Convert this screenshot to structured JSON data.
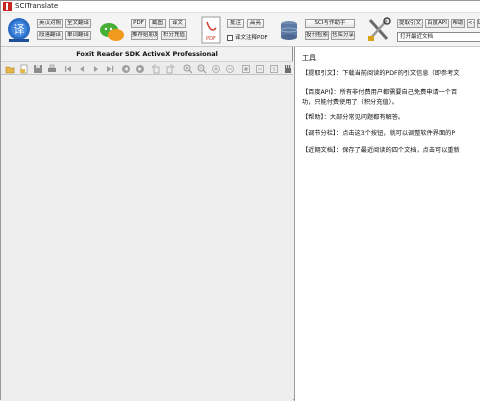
{
  "window": {
    "title": "SCITranslate"
  },
  "ribbon": {
    "buttons": {
      "en_compare": "英汉对照",
      "full_translate": "全文翻译",
      "excerpt_translate": "段落翻译",
      "word_translate": "单词翻译",
      "pdf": "PDF",
      "screenshot": "截图",
      "translate_text": "译文",
      "recommend_friend": "推荐给朋友",
      "points_recharge": "积分充值",
      "annotate": "批注",
      "highlight": "高亮",
      "sci_assistant": "SCI写作助手",
      "journal_search": "投刊检索",
      "repo_share": "仓库分享",
      "extract_citation": "提取引文",
      "baidu_api": "百度API",
      "help": "帮助",
      "collapse": "<<",
      "l": "L"
    },
    "annotate_checkbox_label": "译文注释PDF",
    "recent_input_value": "打开最近文档"
  },
  "foxit": {
    "title": "Foxit Reader SDK ActiveX Professional"
  },
  "help_panel": {
    "heading": "工具",
    "lines": [
      "【提取引文】：下载当前阅读的PDF的引文信息（即参考文",
      "【百度API】：所有非付费用户都需要自己免费申请一个百",
      "功，只能付费使用了（积分充值）。",
      "【帮助】：大部分常见问题都有解答。",
      "【调节分栏】：点击这3个按钮，就可以调整软件界面的P",
      "【近期文档】：保存了最近阅读的四个文档，点击可以重新"
    ]
  },
  "colors": {
    "accent_blue": "#2b6cc4",
    "wechat_green": "#45b035",
    "pdf_red": "#d33a2c"
  }
}
